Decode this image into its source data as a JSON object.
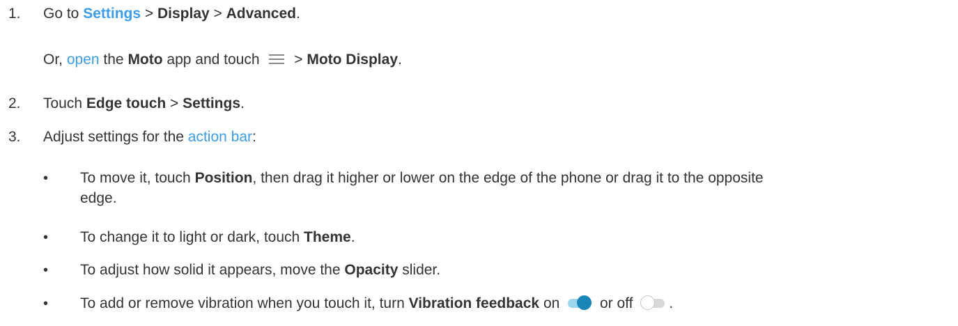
{
  "steps": [
    {
      "number": "1.",
      "go_to": "Go to ",
      "settings_link": "Settings",
      "sep1": " > ",
      "display": "Display",
      "sep2": " > ",
      "advanced": "Advanced",
      "end": ".",
      "alt_or": "Or, ",
      "alt_open_link": "open",
      "alt_the": " the ",
      "alt_moto": "Moto",
      "alt_app_touch": " app and touch ",
      "alt_menu_icon": "menu-icon",
      "alt_sep": " > ",
      "alt_moto_display": "Moto Display",
      "alt_end": "."
    },
    {
      "number": "2.",
      "touch": "Touch ",
      "edge_touch": "Edge touch",
      "sep": " > ",
      "settings": "Settings",
      "end": "."
    },
    {
      "number": "3.",
      "adjust": "Adjust settings for the ",
      "action_bar_link": "action bar",
      "end": ":"
    }
  ],
  "bullets": [
    {
      "symbol": "•",
      "pre": "To move it, touch ",
      "bold": "Position",
      "post": ", then drag it higher or lower on the edge of the phone or drag it to the opposite",
      "post2": "edge."
    },
    {
      "symbol": "•",
      "pre": "To change it to light or dark, touch ",
      "bold": "Theme",
      "post": "."
    },
    {
      "symbol": "•",
      "pre": "To adjust how solid it appears, move the ",
      "bold": "Opacity",
      "post": " slider."
    },
    {
      "symbol": "•",
      "pre": "To add or remove vibration when you touch it, turn ",
      "bold": "Vibration feedback",
      "on": " on ",
      "on_icon": "toggle-on-icon",
      "or_off": " or off ",
      "off_icon": "toggle-off-icon",
      "end": "."
    }
  ],
  "colors": {
    "text": "#333333",
    "link": "#3c9ce6",
    "toggle_on_thumb": "#1a86b8",
    "toggle_on_track": "#9ad6ec",
    "toggle_off_track": "#d9d9d9"
  }
}
